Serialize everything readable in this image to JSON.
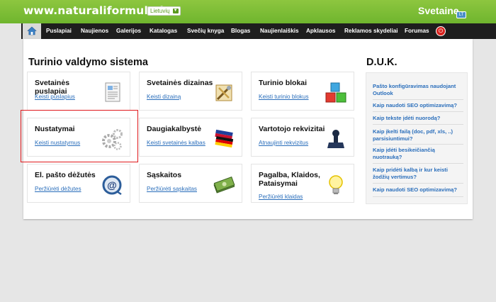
{
  "header": {
    "site_url": "www.naturaliformule.lt",
    "language": "Lietuvių",
    "brand": "Svetaine",
    "brand_badge": "LT"
  },
  "nav": {
    "items": [
      "Puslapiai",
      "Naujienos",
      "Galerijos",
      "Katalogas",
      "Svečių knyga",
      "Blogas",
      "Naujienlaiškis",
      "Apklausos",
      "Reklamos skydeliai",
      "Forumas"
    ]
  },
  "main": {
    "title": "Turinio valdymo sistema",
    "cards": [
      {
        "title": "Svetainės puslapiai",
        "link": "Keisti puslapius",
        "icon": "pages-document-icon"
      },
      {
        "title": "Svetainės dizainas",
        "link": "Keisti dizainą",
        "icon": "design-tools-icon"
      },
      {
        "title": "Turinio blokai",
        "link": "Keisti turinio blokus",
        "icon": "content-blocks-icon"
      },
      {
        "title": "Nustatymai",
        "link": "Keisti nustatymus",
        "icon": "settings-gears-icon"
      },
      {
        "title": "Daugiakalbystė",
        "link": "Keisti svetainės kalbas",
        "icon": "flags-icon"
      },
      {
        "title": "Vartotojo rekvizitai",
        "link": "Atnaujinti rekvizitus",
        "icon": "stamp-icon"
      },
      {
        "title": "El. pašto dėžutės",
        "link": "Peržiūrėti dėžutes",
        "icon": "email-icon"
      },
      {
        "title": "Sąskaitos",
        "link": "Peržiūrėti sąskaitas",
        "icon": "money-icon"
      },
      {
        "title": "Pagalba, Klaidos, Pataisymai",
        "link": "Peržiūrėti klaidas",
        "icon": "lightbulb-icon"
      }
    ]
  },
  "faq": {
    "title": "D.U.K.",
    "items": [
      "Pašto konfigūravimas naudojant Outlook",
      "Kaip naudoti SEO optimizavimą?",
      "Kaip tekste įdėti nuorodą?",
      "Kaip įkelti failą (doc, pdf, xls, ..) parsisiuntimui?",
      "Kaip įdėti besikeičiančią nuotrauką?",
      "Kaip pridėti kalbą ir kur keisti žodžių vertimus?",
      "Kaip naudoti SEO optimizavimą?"
    ]
  },
  "colors": {
    "header_green": "#7cbf38",
    "nav_black": "#1e1e1e",
    "link_blue": "#2a6ebb",
    "highlight_red": "#e0191d"
  }
}
